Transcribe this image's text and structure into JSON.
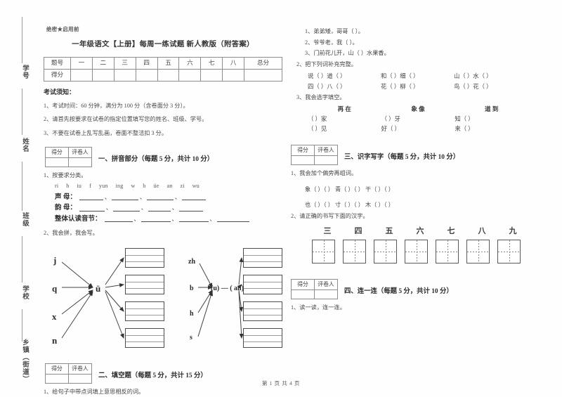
{
  "document": {
    "secret_mark": "绝密★启用前",
    "title": "一年级语文【上册】每周一练试题 新人教版（附答案）",
    "footer": "第 1 页  共 4 页"
  },
  "binding": {
    "labels": [
      "学号",
      "姓名",
      "班级",
      "学校",
      "乡镇（街道）"
    ]
  },
  "score_table": {
    "row_label_1": "题号",
    "row_label_2": "得分",
    "columns": [
      "一",
      "二",
      "三",
      "四",
      "五",
      "六",
      "七",
      "八",
      "总分"
    ]
  },
  "notice": {
    "title": "考试须知：",
    "items": [
      "1、考试时间：60 分钟，满分为 100 分（含卷面分 3 分）。",
      "2、请首先按要求在试卷的指定位置填写您的姓名、班级、学号。",
      "3、不要在试卷上乱写乱画，卷面不整洁扣 3 分。"
    ]
  },
  "grader_box": {
    "score_label": "得分",
    "grader_label": "评卷人"
  },
  "sections": {
    "one": {
      "title": "一、拼音部分（每题 5 分，共计 10 分）",
      "q1": "1、按要求分类。",
      "letters": [
        "ri",
        "h",
        "iu",
        "f",
        "yun",
        "ing",
        "w",
        "b",
        "üe",
        "an",
        "zi",
        "wu"
      ],
      "fill_rows": [
        {
          "label": "声  母：",
          "blanks": 4
        },
        {
          "label": "韵  母：",
          "blanks": 4
        },
        {
          "label": "整体认读音节：",
          "blanks": 4
        }
      ],
      "q2": "2、我会拼，我会写。",
      "diagram_left": {
        "initials": [
          "j",
          "q",
          "x",
          "n"
        ],
        "final": "ü"
      },
      "diagram_right": {
        "initials": [
          "zh",
          "b",
          "h",
          "s"
        ],
        "final": "(u) — ( an)"
      }
    },
    "two": {
      "title": "二、填空题（每题 5 分，共计 15 分）",
      "q1": "1、给句子中带点词填上意思相反的词。",
      "antonyms": [
        "1、弟弟矮，哥哥（    ）。",
        "2、爷爷老，我（    ）。",
        "3、门前花儿开，山（    ）水果香。"
      ],
      "q2": "2、把下列词补充完整。",
      "word_rows": [
        [
          "说（  ）道（  ）",
          "和（  ）细（  ）",
          "山（  ）水（  ）"
        ],
        [
          "四（  ）八（  ）",
          "花（  ）柳（  ）",
          "鸟（  ）花（  ）"
        ]
      ],
      "q3": "3、我会选字填空。",
      "choice_heads": [
        "再   在",
        "象   像",
        "道   到"
      ],
      "choice_rows": [
        [
          "（      ）家",
          "（      ）牙",
          "知（      ）"
        ],
        [
          "（      ）见",
          "好（      ）",
          "来（      ）"
        ]
      ]
    },
    "three": {
      "title": "三、识字写字（每题 5 分，共计 10 分）",
      "q1": "1、我会加个偏旁再组词。",
      "radical_rows": [
        "象（  ）（      ）  青（  ）（      ）  干（  ）（      ）",
        "也（  ）（      ）  寸（  ）（      ）  木（  ）（      ）"
      ],
      "q2": "2、请正确的书写下面的汉字。",
      "chars": [
        "三",
        "四",
        "五",
        "六",
        "七",
        "八",
        "九"
      ]
    },
    "four": {
      "title": "四、连一连（每题 5 分，共计 10 分）",
      "q1": "1、读一读，连一连。"
    }
  }
}
